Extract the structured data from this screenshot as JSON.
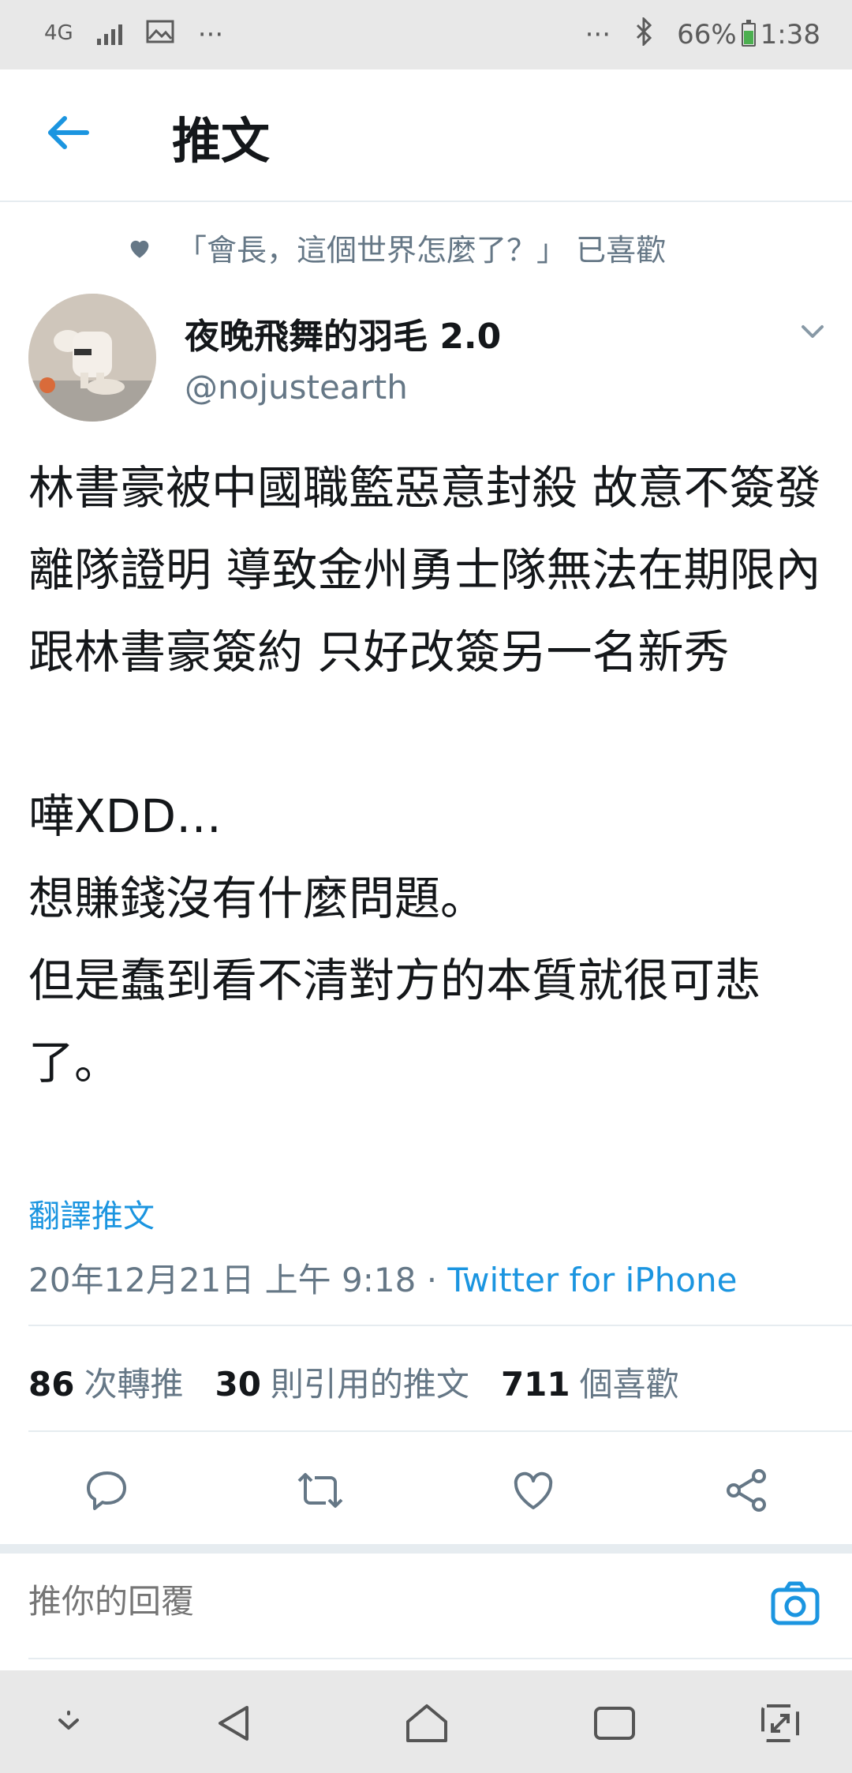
{
  "status_bar": {
    "network": "4G",
    "more_left": "···",
    "more_right": "···",
    "battery": "66%",
    "battery_level": 0.66,
    "time": "1:38"
  },
  "header": {
    "title": "推文"
  },
  "liked_by": {
    "text": "「會長，這個世界怎麼了？」 已喜歡"
  },
  "author": {
    "name": "夜晚飛舞的羽毛 2.0",
    "handle": "@nojustearth"
  },
  "tweet": {
    "body": "林書豪被中國職籃惡意封殺 故意不簽發離隊證明 導致金州勇士隊無法在期限內跟林書豪簽約 只好改簽另一名新秀\n\n嘩XDD…\n想賺錢沒有什麼問題。\n但是蠢到看不清對方的本質就很可悲了。",
    "translate_label": "翻譯推文",
    "timestamp": "20年12月21日 上午 9:18",
    "separator": " · ",
    "source": "Twitter for iPhone"
  },
  "stats": {
    "retweets": "86",
    "retweets_label": "次轉推",
    "quotes": "30",
    "quotes_label": "則引用的推文",
    "likes": "711",
    "likes_label": "個喜歡"
  },
  "reply": {
    "placeholder": "推你的回覆"
  },
  "colors": {
    "accent": "#1b95e0",
    "secondary_text": "#657786",
    "primary_text": "#14171a"
  }
}
